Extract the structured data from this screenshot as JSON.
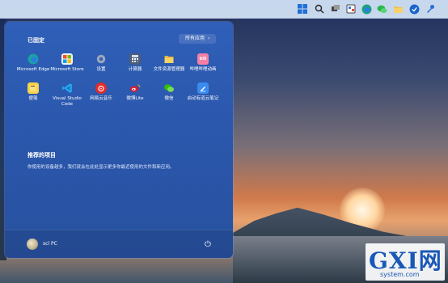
{
  "taskbar": {
    "icons": [
      "windows-start-icon",
      "search-icon",
      "task-view-icon",
      "widgets-icon",
      "edge-icon",
      "chat-icon",
      "file-explorer-icon",
      "store-icon",
      "tool-icon"
    ]
  },
  "start_menu": {
    "pinned_title": "已固定",
    "all_apps_label": "所有应用",
    "all_apps_chevron": "›",
    "apps": [
      {
        "label": "Microsoft Edge"
      },
      {
        "label": "Microsoft Store"
      },
      {
        "label": "设置"
      },
      {
        "label": "计算器"
      },
      {
        "label": "文件资源管理器"
      },
      {
        "label": "哔哩哔哩动画"
      },
      {
        "label": "便笺"
      },
      {
        "label": "Visual Studio Code"
      },
      {
        "label": "网易云音乐"
      },
      {
        "label": "微博Lite"
      },
      {
        "label": "微信"
      },
      {
        "label": "启动有道云笔记"
      }
    ],
    "recommended_title": "推荐的项目",
    "recommended_desc": "你使用的设备越多，我们就会在此处显示更多你最近使用的文件和新应用。",
    "user_name": "scl PC",
    "power_glyph": "⏻"
  },
  "watermark": {
    "logo": "GXI网",
    "url": "system.com"
  }
}
